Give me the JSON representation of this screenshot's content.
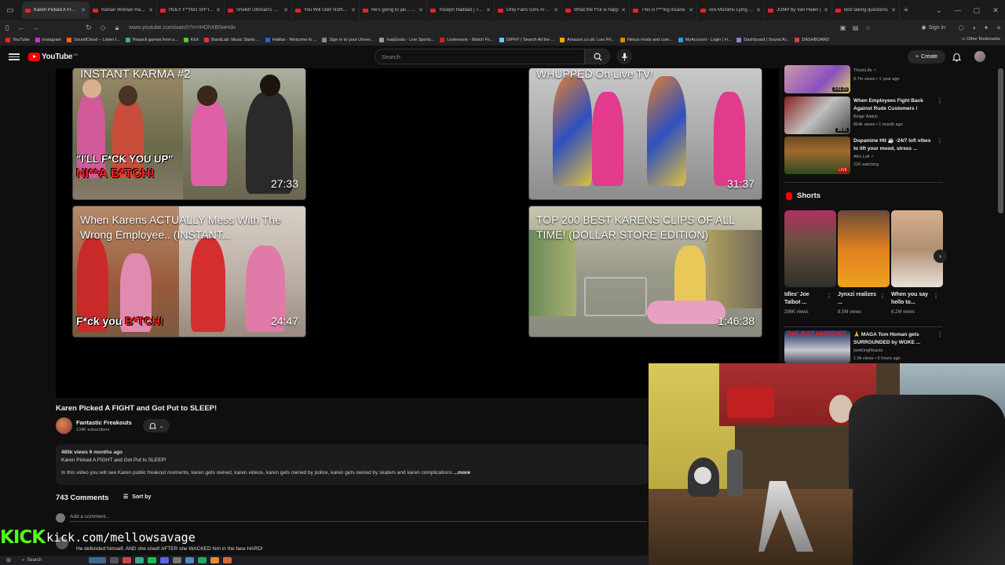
{
  "browser": {
    "tabs": [
      {
        "title": "Karen Picked A FIGHT",
        "active": true
      },
      {
        "title": "Iranian Woman Has U"
      },
      {
        "title": "HOLY F**ING SH*T..."
      },
      {
        "title": "Sheikh Uthman's Dec"
      },
      {
        "title": "You Will Own Nothing"
      },
      {
        "title": "He's going to jail... - Yo"
      },
      {
        "title": "Yoseph Haddad | Tho"
      },
      {
        "title": "Only Fans Girls Are M"
      },
      {
        "title": "What the f*ck is happ"
      },
      {
        "title": "This is f***ing insane."
      },
      {
        "title": "Are Muslims Lying Ab"
      },
      {
        "title": "JUMP by Van Halen |"
      },
      {
        "title": "Bob taking questions"
      }
    ],
    "url": "www.youtube.com/watch?v=IHOhXB0wHdo",
    "sign_in": "Sign in",
    "bookmarks": [
      {
        "label": "YouTube",
        "color": "#e22"
      },
      {
        "label": "Instagram",
        "color": "#c3c"
      },
      {
        "label": "SoundCloud – Listen t...",
        "color": "#f60"
      },
      {
        "label": "Repack games from s...",
        "color": "#4a8"
      },
      {
        "label": "Kick",
        "color": "#5c2"
      },
      {
        "label": "BandLab: Music Starts ...",
        "color": "#e33"
      },
      {
        "label": "Halifax - Welcome to ...",
        "color": "#26c"
      },
      {
        "label": "Sign in to your Univer...",
        "color": "#888"
      },
      {
        "label": "IraqGoals - Live Sports...",
        "color": "#999"
      },
      {
        "label": "Lookmovie - Watch Fo...",
        "color": "#c22"
      },
      {
        "label": "GIPHY | Search All the ...",
        "color": "#6cf"
      },
      {
        "label": "Amazon.co.uk: Low Pri...",
        "color": "#fa0"
      },
      {
        "label": "Nexus mods and com...",
        "color": "#d80"
      },
      {
        "label": "MyAccount - Login | H...",
        "color": "#39d"
      },
      {
        "label": "Dashboard | Sound Al...",
        "color": "#88c"
      },
      {
        "label": "DASHBOARD",
        "color": "#c44"
      }
    ],
    "other_bookmarks": "Other Bookmarks"
  },
  "youtube": {
    "logo": "YouTube",
    "logo_country": "GB",
    "search_placeholder": "Search",
    "create_label": "Create"
  },
  "end_screen": [
    {
      "title": "INSTANT KARMA #2",
      "duration": "27:33",
      "caption_a": "\"I'LL F*CK YOU UP\"",
      "caption_b": "NI**A B*TCH!"
    },
    {
      "title": "WHUPPED On Live TV!",
      "duration": "31:37"
    },
    {
      "title": "When Karens ACTUALLY Mess With The Wrong Employee.. (INSTANT...",
      "duration": "24:47",
      "caption_a": "F*ck you ",
      "caption_b": "B*TCH!"
    },
    {
      "title": "TOP 200 BEST KARENS CLIPS OF ALL TIME! (DOLLAR STORE EDITION)",
      "duration": "1:46:38"
    }
  ],
  "video": {
    "title": "Karen Picked A FIGHT and Got Put to SLEEP!",
    "channel": "Fantastic Freakouts",
    "subscribers": "134K subscribers",
    "views_age": "485k views  6 months ago",
    "desc_line1": "Karen Picked A FIGHT and Got Put to SLEEP!",
    "desc_line2": "In this video you will see Karen public freakout moments, karen gets owned, karen videos, karen gets owned by police, karen gets owned by skaters and karen complications",
    "more": "...more"
  },
  "comments": {
    "count": "743 Comments",
    "sort_label": "Sort by",
    "add_placeholder": "Add a comment...",
    "first_comment": "He defended himself, AND she cried! AFTER she WACKED  him in the face HARD!"
  },
  "sidebar": {
    "recs": [
      {
        "title": "",
        "channel": "ThisIsLife",
        "views": "9.7m views • 1 year ago",
        "duration": "2:01:22"
      },
      {
        "title": "When Employees Fight Back Against Rude Customers !",
        "channel": "Binge Watch",
        "views": "864k views • 1 month ago",
        "duration": "28:01"
      },
      {
        "title": "Dopamine Hit ☕ -24/7 lofi vibes to lift your mood, stress ...",
        "channel": "Afro Lofi",
        "views": "226 watching",
        "live": "LIVE"
      }
    ],
    "shorts_heading": "Shorts",
    "shorts": [
      {
        "title": "Idles' Joe Talbot ...",
        "views": "296K views"
      },
      {
        "title": "Jynxzi realizes ...",
        "views": "8.5M views"
      },
      {
        "title": "When you say hello to...",
        "views": "6.2M views"
      }
    ],
    "last_rec": {
      "title": "🙏 MAGA Tom Homan gets SURROUNDED by WOKE ...",
      "channel": "IamKingReacts",
      "views": "1.9k views • 5 hours ago",
      "thumb_text": "THIS JUST HAPPENED"
    }
  },
  "overlay": {
    "kick_logo": "KICK",
    "kick_url": "kick.com/mellowsavage"
  },
  "taskbar": {
    "search": "Search"
  }
}
